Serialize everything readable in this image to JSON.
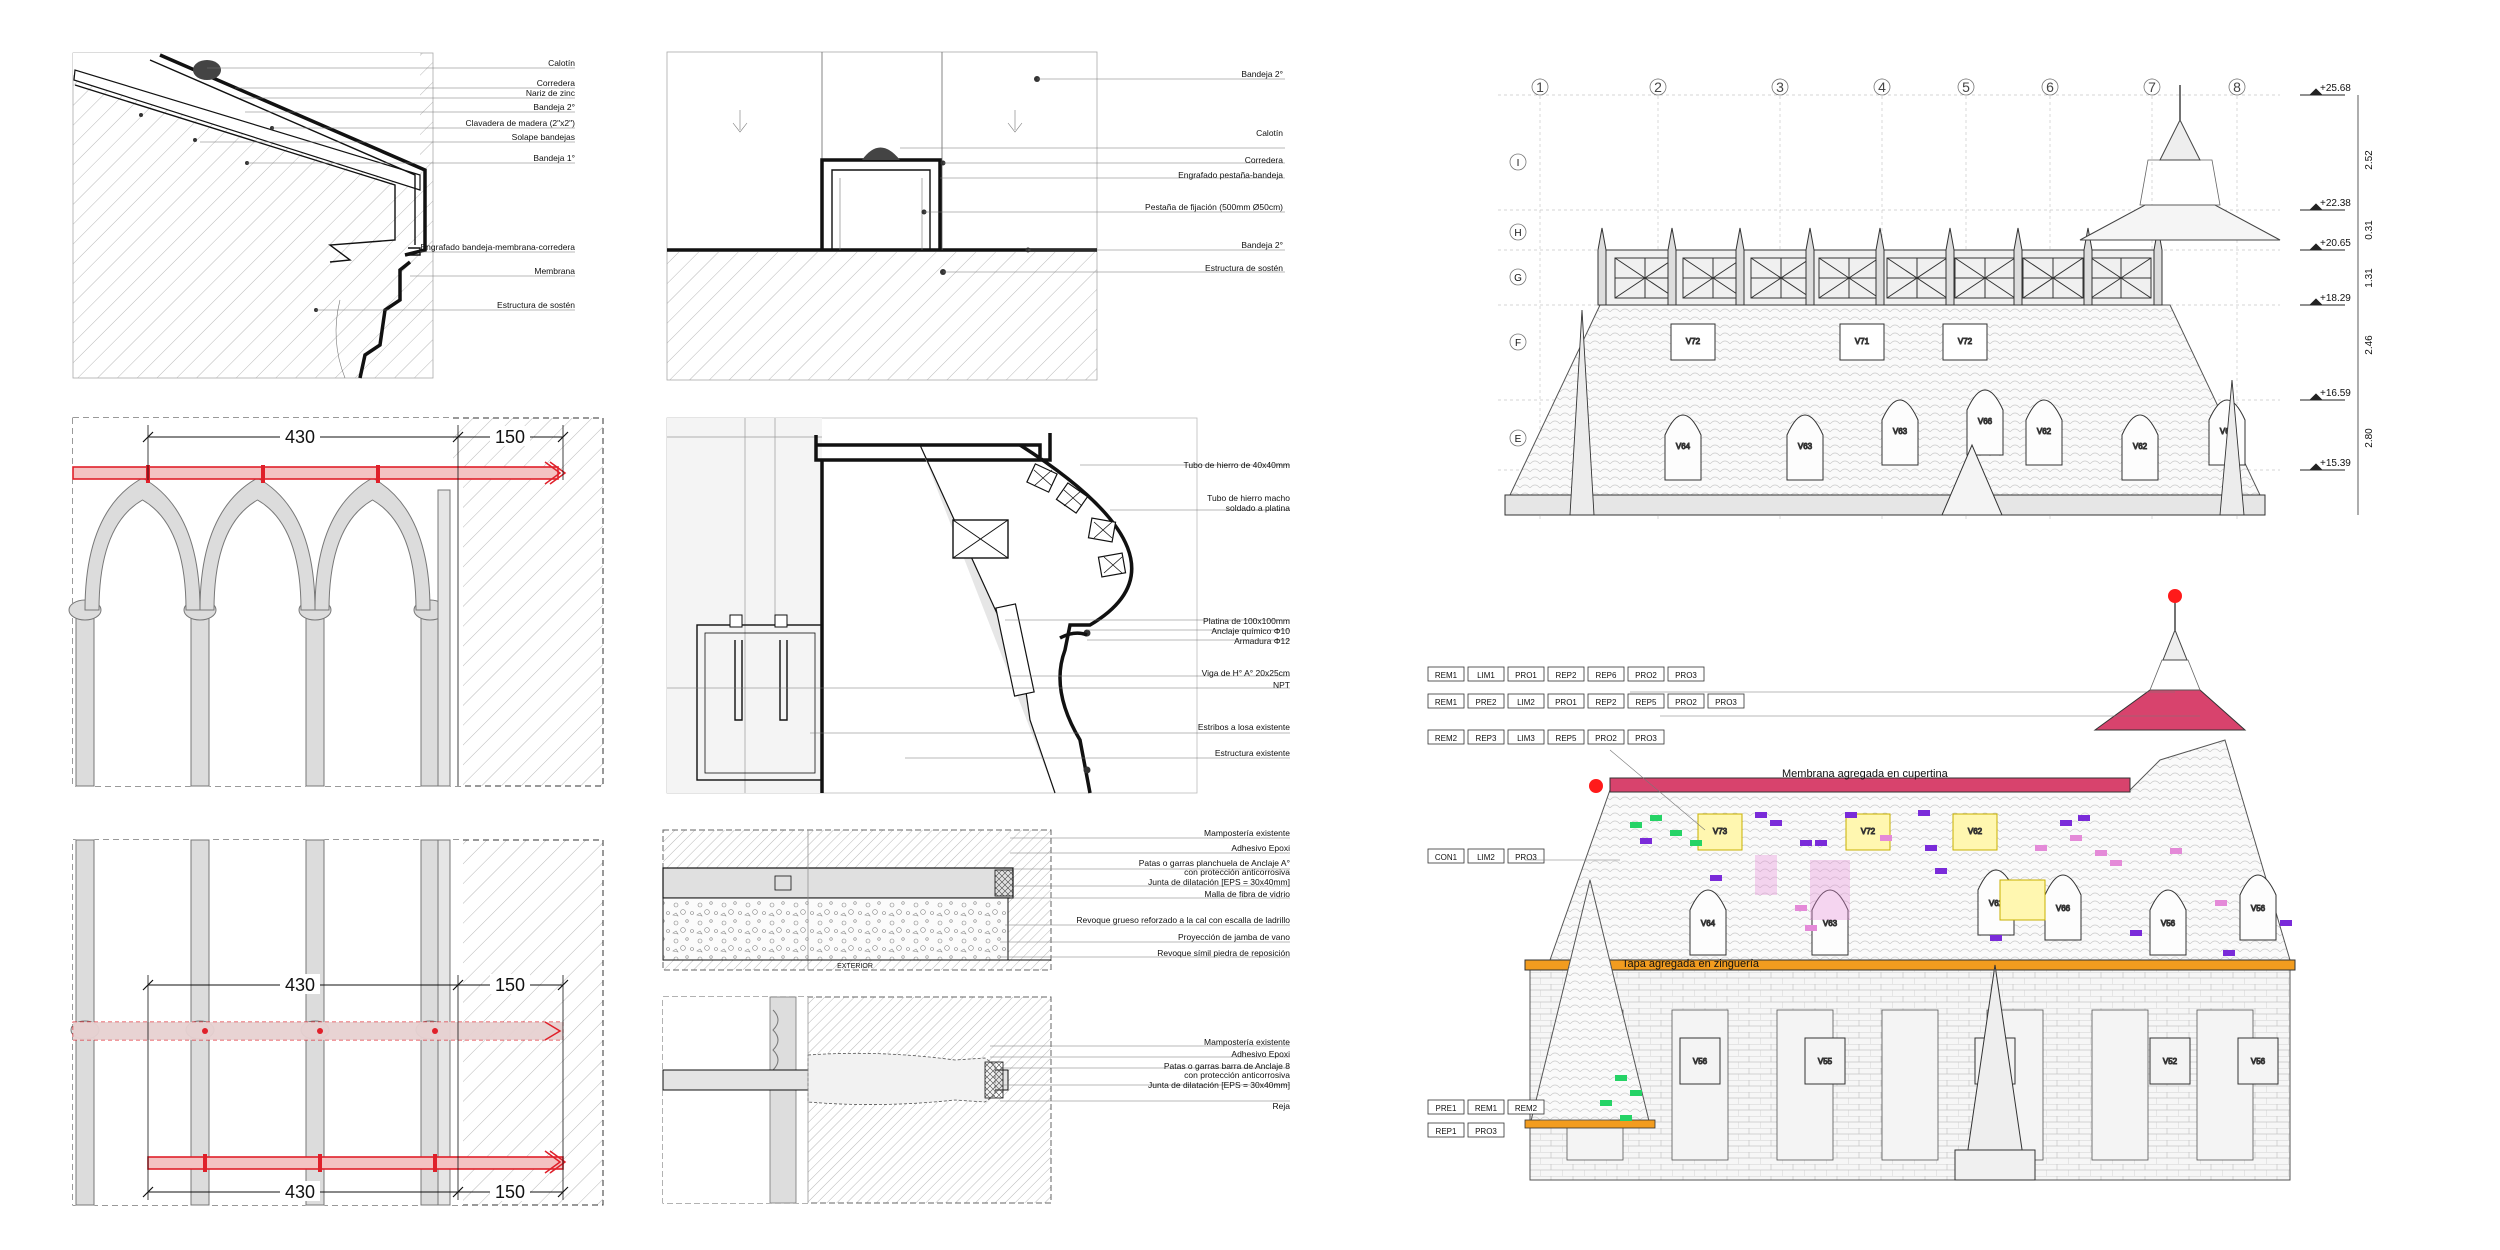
{
  "details": {
    "roof_edge": {
      "labels": [
        "Calotín",
        "Corredera",
        "Nariz de zinc",
        "Bandeja 2°",
        "Clavadera de madera (2\"x2\")",
        "Solape bandejas",
        "Bandeja 1°",
        "Engrafado bandeja-membrana-corredera",
        "Membrana",
        "Estructura de sostén"
      ]
    },
    "seam_section": {
      "labels": [
        "Bandeja 2°",
        "Calotín",
        "Corredera",
        "Engrafado pestaña-bandeja",
        "Pestaña de fijación (500mm Ø50cm)",
        "Bandeja 2°",
        "Estructura de sostén"
      ]
    },
    "cornice_section": {
      "labels": [
        "Tubo de hierro de 40x40mm",
        "Tubo de hierro macho",
        "soldado a platina",
        "Platina de 100x100mm",
        "Anclaje químico Φ10",
        "Armadura Φ12",
        "Viga de H° A° 20x25cm",
        "NPT",
        "Estribos a losa existente",
        "Estructura existente"
      ]
    },
    "arcade_top": {
      "dims": [
        "430",
        "150"
      ]
    },
    "arcade_bottom": {
      "dims": [
        "430",
        "150",
        "430",
        "150"
      ]
    },
    "anchor_detail_1": {
      "labels": [
        "Mampostería existente",
        "Adhesivo Epoxi",
        "Patas o garras  planchuela de Anclaje A°",
        "con protección anticorrosiva",
        "Junta de dilatación  [EPS = 30x40mm]",
        "Malla de fibra de vidrio",
        "Revoque grueso reforzado a la cal con escalla de ladrillo",
        "Proyección de jamba de vano",
        "Revoque símil piedra de reposición"
      ],
      "caption": "EXTERIOR"
    },
    "anchor_detail_2": {
      "labels": [
        "Mampostería existente",
        "Adhesivo Epoxi",
        "Patas o garras  barra de Anclaje 8",
        "con protección anticorrosiva",
        "Junta de dilatación  [EPS = 30x40mm]",
        "Reja"
      ]
    }
  },
  "elevation": {
    "column_axes": [
      "1",
      "2",
      "3",
      "4",
      "5",
      "6",
      "7",
      "8"
    ],
    "row_axes": [
      "I",
      "H",
      "G",
      "F",
      "E"
    ],
    "levels": [
      "+25.68",
      "+22.38",
      "+20.65",
      "+18.29",
      "+16.59",
      "+15.39"
    ],
    "spacings": [
      "2.52",
      "0.31",
      "1.31",
      "2.46",
      "2.80"
    ],
    "window_tags": [
      "V72",
      "V71",
      "V72",
      "V64",
      "V63",
      "V63",
      "V62",
      "V62",
      "V66",
      "V66"
    ]
  },
  "survey": {
    "tag_rows": [
      [
        "REM1",
        "LIM1",
        "PRO1",
        "REP2",
        "REP6",
        "PRO2",
        "PRO3"
      ],
      [
        "REM1",
        "PRE2",
        "LIM2",
        "PRO1",
        "REP2",
        "REP5",
        "PRO2",
        "PRO3"
      ],
      [
        "REM2",
        "REP3",
        "LIM3",
        "REP5",
        "PRO2",
        "PRO3"
      ],
      [
        "CON1",
        "LIM2",
        "PRO3"
      ],
      [
        "PRE1",
        "REM1",
        "REM2"
      ],
      [
        "REP1",
        "PRO3"
      ]
    ],
    "annotations": [
      "Membrana agregada en cupertina",
      "Tapa agregada en zinguería"
    ],
    "window_tags": [
      "V73",
      "V72",
      "V62",
      "V64",
      "V63",
      "V62",
      "V66",
      "V56",
      "V56",
      "V55",
      "V56",
      "V52",
      "V56"
    ]
  },
  "colors": {
    "line": "#111111",
    "redline": "#e0202a",
    "redfill": "#f4c2c2",
    "membrane": "#d8436d",
    "orange": "#f29c1f",
    "green": "#25d366",
    "purple": "#7a2bd9",
    "pink": "#e48ad8",
    "yellow": "#fff7b0"
  }
}
